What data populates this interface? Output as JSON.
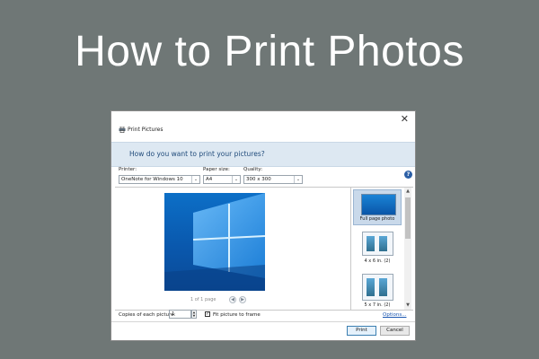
{
  "page": {
    "headline": "How to Print Photos"
  },
  "dialog": {
    "title": "Print Pictures",
    "question": "How do you want to print your pictures?",
    "printer": {
      "label": "Printer:",
      "value": "OneNote for Windows 10"
    },
    "paper_size": {
      "label": "Paper size:",
      "value": "A4"
    },
    "quality": {
      "label": "Quality:",
      "value": "300 x 300"
    },
    "help_glyph": "?",
    "close_glyph": "✕",
    "preview": {
      "page_info": "1 of 1 page",
      "prev_glyph": "◀",
      "next_glyph": "▶",
      "image_icon": "windows-10-wallpaper-icon"
    },
    "layouts": [
      {
        "label": "Full page photo",
        "selected": true
      },
      {
        "label": "4 x 6 in. (2)",
        "selected": false
      },
      {
        "label": "5 x 7 in. (2)",
        "selected": false
      }
    ],
    "scroll": {
      "up_glyph": "▲",
      "down_glyph": "▼"
    },
    "copies": {
      "label": "Copies of each picture:",
      "value": "1",
      "up_glyph": "▲",
      "down_glyph": "▼"
    },
    "fit_to_frame": {
      "label": "Fit picture to frame",
      "checked": true,
      "check_glyph": "✓"
    },
    "options_label": "Options...",
    "buttons": {
      "print": "Print",
      "cancel": "Cancel"
    }
  },
  "colors": {
    "background": "#6f7776",
    "accent_band": "#dde8f2",
    "accent_text": "#1f4a7a",
    "link": "#1a56b0"
  }
}
